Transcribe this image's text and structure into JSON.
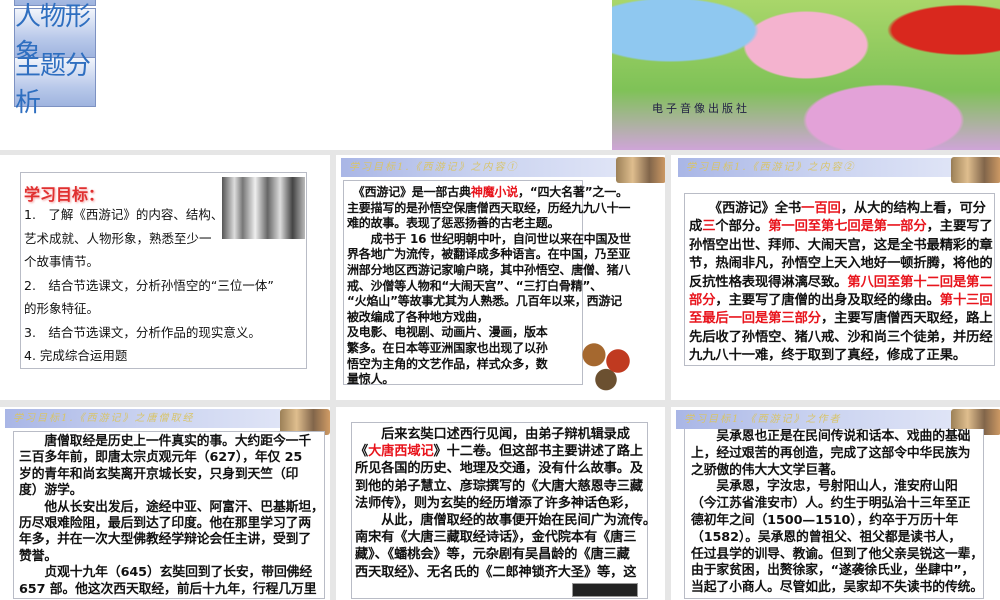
{
  "top_slide": {
    "nav": [
      "人物形象",
      "主题分析"
    ],
    "cover_logo": "电子音像出版社"
  },
  "slides": [
    {
      "goal_title": "学习目标：",
      "goals": [
        "1.　了解《西游记》的内容、结构、",
        "艺术成就、人物形象，熟悉至少一",
        "个故事情节。",
        "2.　结合节选课文，分析孙悟空的“三位一体”",
        "的形象特征。",
        "3.　结合节选课文，分析作品的现实意义。",
        "4.  完成综合运用题"
      ]
    },
    {
      "banner": "学习目标1.《西游记》之内容①",
      "lines": [
        [
          {
            "t": "　《西游记》是一部古典"
          },
          {
            "t": "神魔小说",
            "red": true
          },
          {
            "t": "，“四大名著”之一。"
          }
        ],
        [
          {
            "t": "主要描写的是孙悟空保唐僧西天取经，历经九九八十一"
          }
        ],
        [
          {
            "t": "难的故事。表现了惩恶扬善的古老主题。"
          }
        ],
        [
          {
            "t": "　　成书于 16 世纪明朝中叶，自问世以来在中国及世"
          }
        ],
        [
          {
            "t": "界各地广为流传，被翻译成多种语言。在中国，乃至亚"
          }
        ],
        [
          {
            "t": "洲部分地区西游记家喻户晓，其中孙悟空、唐僧、猪八"
          }
        ],
        [
          {
            "t": "戒、沙僧等人物和“大闹天宫”、“三打白骨精”、"
          }
        ],
        [
          {
            "t": "“火焰山”等故事尤其为人熟悉。几百年以来，西游记"
          }
        ],
        [
          {
            "t": "被改编成了各种地方戏曲，"
          }
        ],
        [
          {
            "t": "及电影、电视剧、动画片、漫画，版本"
          }
        ],
        [
          {
            "t": "繁多。在日本等亚洲国家也出现了以孙"
          }
        ],
        [
          {
            "t": "悟空为主角的文艺作品，样式众多，数"
          }
        ],
        [
          {
            "t": "量惊人。"
          }
        ]
      ]
    },
    {
      "banner": "学习目标1.《西游记》之内容②",
      "lines": [
        [
          {
            "t": "　　《西游记》全书"
          },
          {
            "t": "一百回",
            "red": true
          },
          {
            "t": "，从大的结构上看，可分"
          }
        ],
        [
          {
            "t": "成"
          },
          {
            "t": "三",
            "red": true
          },
          {
            "t": "个部分。"
          },
          {
            "t": "第一回至第七回是第一部分",
            "red": true
          },
          {
            "t": "，主要写了"
          }
        ],
        [
          {
            "t": "孙悟空出世、拜师、大闹天宫，这是全书最精彩的章"
          }
        ],
        [
          {
            "t": "节，热闹非凡，孙悟空上天入地好一顿折腾，将他的"
          }
        ],
        [
          {
            "t": "反抗性格表现得淋漓尽致。"
          },
          {
            "t": "第八回至第十二回是第二",
            "red": true
          }
        ],
        [
          {
            "t": "部分",
            "red": true
          },
          {
            "t": "，主要写了唐僧的出身及取经的缘由。"
          },
          {
            "t": "第十三回",
            "red": true
          }
        ],
        [
          {
            "t": "至最后一回是第三部分",
            "red": true
          },
          {
            "t": "，主要写唐僧西天取经，路上"
          }
        ],
        [
          {
            "t": "先后收了孙悟空、猪八戒、沙和尚三个徒弟，并历经"
          }
        ],
        [
          {
            "t": "九九八十一难，终于取到了真经，修成了正果。"
          }
        ]
      ]
    },
    {
      "banner": "学习目标1.《西游记》之唐僧取经",
      "lines": [
        [
          {
            "t": "　　唐僧取经是历史上一件真实的事。大约距今一千"
          }
        ],
        [
          {
            "t": "三百多年前，即唐太宗贞观元年（627），年仅 25"
          }
        ],
        [
          {
            "t": "岁的青年和尚玄奘离开京城长安，只身到天竺（印"
          }
        ],
        [
          {
            "t": "度）游学。"
          }
        ],
        [
          {
            "t": "　　他从长安出发后，途经中亚、阿富汗、巴基斯坦，"
          }
        ],
        [
          {
            "t": "历尽艰难险阻，最后到达了印度。他在那里学习了两"
          }
        ],
        [
          {
            "t": "年多，并在一次大型佛教经学辩论会任主讲，受到了"
          }
        ],
        [
          {
            "t": "赞誉。"
          }
        ],
        [
          {
            "t": "　　贞观十九年（645）玄奘回到了长安，带回佛经"
          }
        ],
        [
          {
            "t": "657 部。他这次西天取经，前后十九年，行程几万里"
          }
        ]
      ]
    },
    {
      "lines": [
        [
          {
            "t": "　　后来玄奘口述西行见闻，由弟子辩机辑录成"
          }
        ],
        [
          {
            "t": "《"
          },
          {
            "t": "大唐西域记",
            "red": true
          },
          {
            "t": "》十二卷。但这部书主要讲述了路上"
          }
        ],
        [
          {
            "t": "所见各国的历史、地理及交通，没有什么故事。及"
          }
        ],
        [
          {
            "t": "到他的弟子慧立、彦琮撰写的《大唐大慈恩寺三藏"
          }
        ],
        [
          {
            "t": "法师传》，则为玄奘的经历增添了许多神话色彩，"
          }
        ],
        [
          {
            "t": " "
          }
        ],
        [
          {
            "t": "　　从此，唐僧取经的故事便开始在民间广为流传。"
          }
        ],
        [
          {
            "t": "南宋有《大唐三藏取经诗话》，金代院本有《唐三"
          }
        ],
        [
          {
            "t": "藏》、《蟠桃会》等，元杂剧有吴昌龄的《唐三藏"
          }
        ],
        [
          {
            "t": "西天取经》、无名氏的《二郎神锁齐大圣》等，这"
          }
        ]
      ]
    },
    {
      "banner": "学习目标1.《西游记》之作者",
      "lines": [
        [
          {
            "t": "　　吴承恩也正是在民间传说和话本、戏曲的基础"
          }
        ],
        [
          {
            "t": "上，经过艰苦的再创造，完成了这部令中华民族为"
          }
        ],
        [
          {
            "t": "之骄傲的伟大大文学巨著。"
          }
        ],
        [
          {
            "t": "　　吴承恩，字汝忠，号射阳山人，淮安府山阳"
          }
        ],
        [
          {
            "t": "（今江苏省淮安市）人。约生于明弘治十三年至正"
          }
        ],
        [
          {
            "t": "德初年之间（1500—1510），约卒于万历十年"
          }
        ],
        [
          {
            "t": "（1582）。吴承恩的曾祖父、祖父都是读书人，"
          }
        ],
        [
          {
            "t": "任过县学的训导、教谕。但到了他父亲吴锐这一辈，"
          }
        ],
        [
          {
            "t": "由于家贫困，出赘徐家，“遂袭徐氏业，坐肆中”，"
          }
        ],
        [
          {
            "t": "当起了小商人。尽管如此，吴家却不失读书的传统。"
          }
        ]
      ]
    }
  ]
}
